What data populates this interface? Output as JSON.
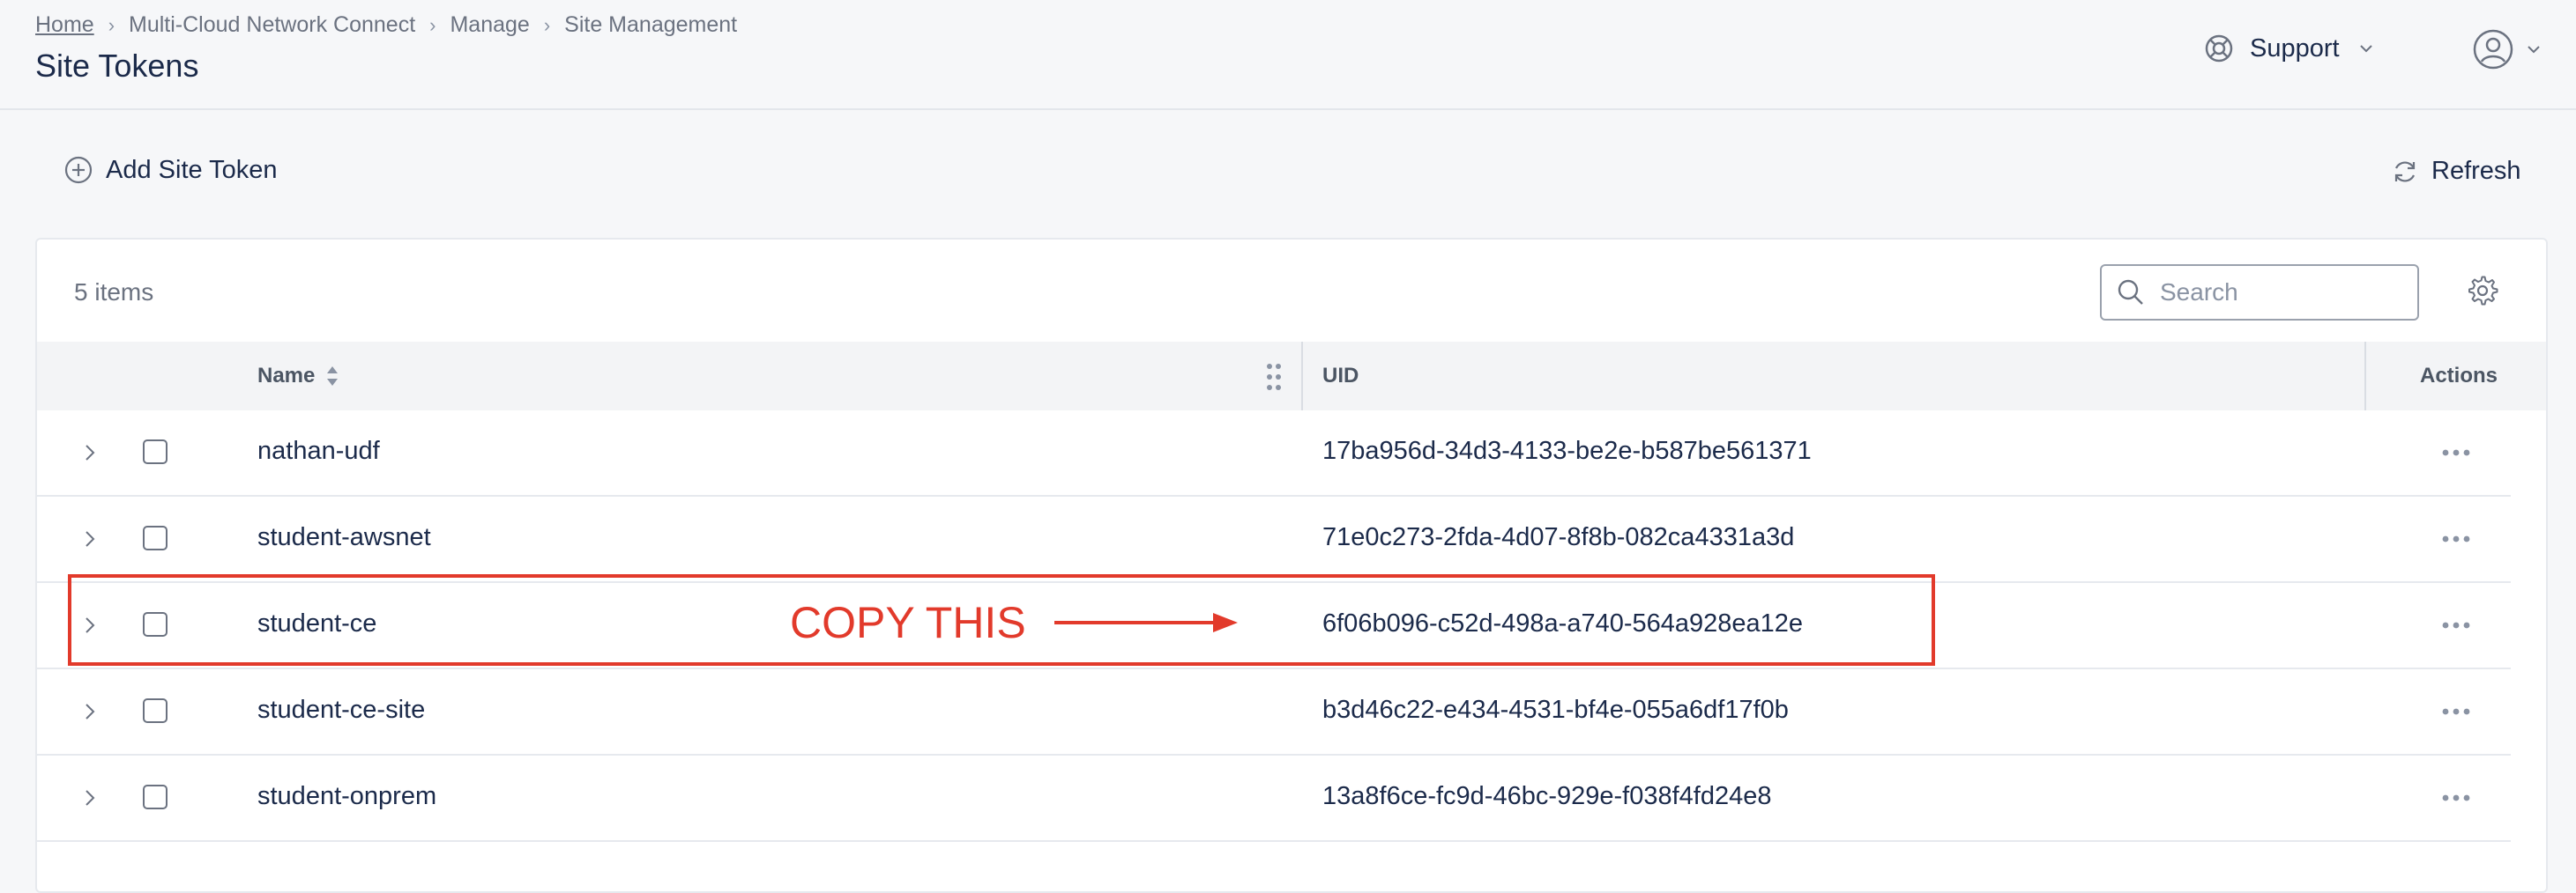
{
  "breadcrumb": {
    "items": [
      "Home",
      "Multi-Cloud Network Connect",
      "Manage",
      "Site Management"
    ]
  },
  "page": {
    "title": "Site Tokens"
  },
  "header": {
    "support_label": "Support"
  },
  "toolbar": {
    "add_label": "Add Site Token",
    "refresh_label": "Refresh"
  },
  "table": {
    "item_count": "5 items",
    "search_placeholder": "Search",
    "columns": {
      "name": "Name",
      "uid": "UID",
      "actions": "Actions"
    },
    "rows": [
      {
        "name": "nathan-udf",
        "uid": "17ba956d-34d3-4133-be2e-b587be561371"
      },
      {
        "name": "student-awsnet",
        "uid": "71e0c273-2fda-4d07-8f8b-082ca4331a3d"
      },
      {
        "name": "student-ce",
        "uid": "6f06b096-c52d-498a-a740-564a928ea12e"
      },
      {
        "name": "student-ce-site",
        "uid": "b3d46c22-e434-4531-bf4e-055a6df17f0b"
      },
      {
        "name": "student-onprem",
        "uid": "13a8f6ce-fc9d-46bc-929e-f038f4fd24e8"
      }
    ]
  },
  "annotation": {
    "label": "COPY THIS",
    "color": "#e23a2b"
  },
  "icons": [
    "chevron-right-icon",
    "lifebuoy-icon",
    "chevron-down-icon",
    "user-circle-icon",
    "plus-circle-icon",
    "refresh-icon",
    "search-icon",
    "gear-icon",
    "sort-icon",
    "drag-handle-icon",
    "more-horizontal-icon"
  ]
}
